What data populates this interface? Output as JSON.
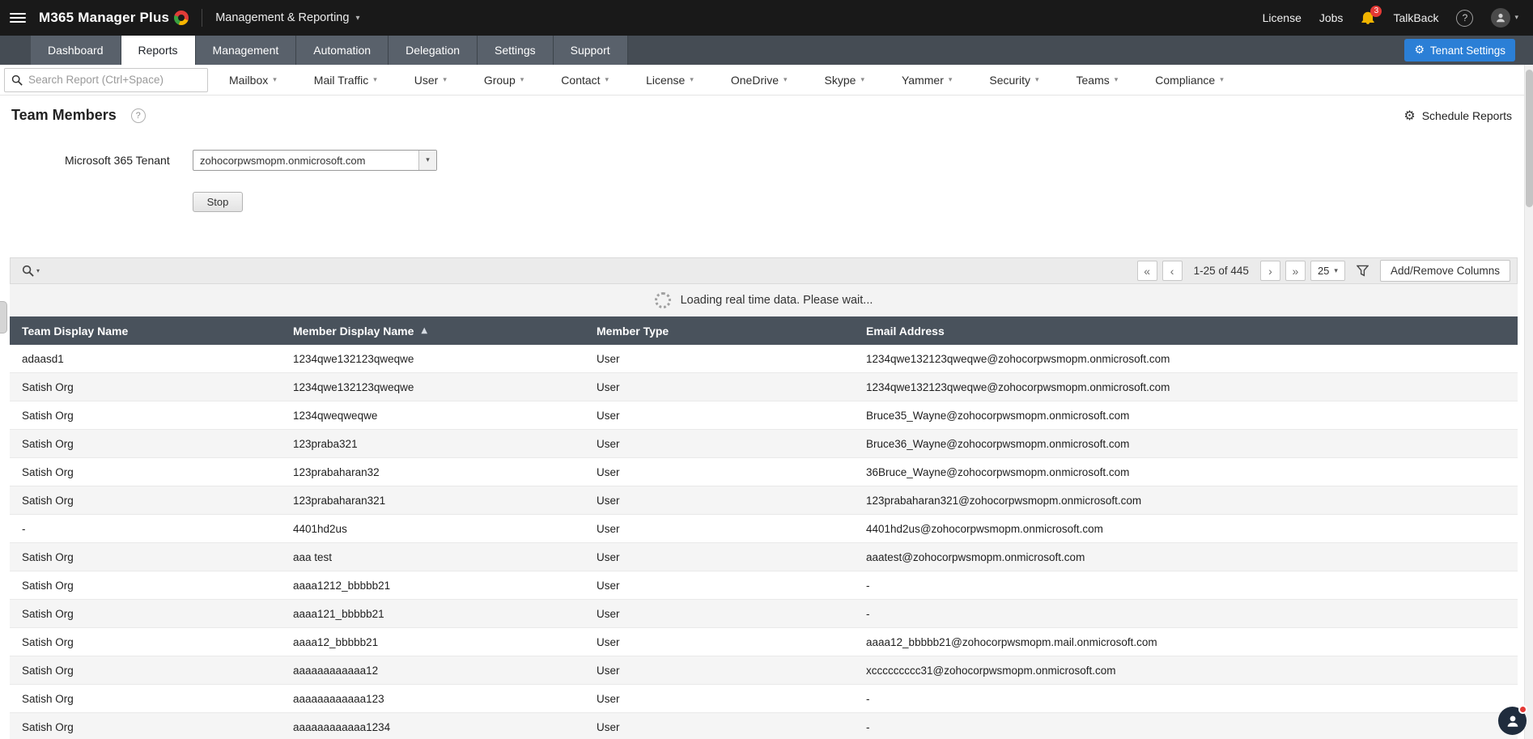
{
  "topbar": {
    "app_name": "M365 Manager Plus",
    "module": "Management & Reporting",
    "license": "License",
    "jobs": "Jobs",
    "notification_count": "3",
    "talkback": "TalkBack"
  },
  "nav": {
    "tabs": [
      "Dashboard",
      "Reports",
      "Management",
      "Automation",
      "Delegation",
      "Settings",
      "Support"
    ],
    "active_tab": "Reports",
    "tenant_settings": "Tenant Settings"
  },
  "report_bar": {
    "search_placeholder": "Search Report (Ctrl+Space)",
    "categories": [
      "Mailbox",
      "Mail Traffic",
      "User",
      "Group",
      "Contact",
      "License",
      "OneDrive",
      "Skype",
      "Yammer",
      "Security",
      "Teams",
      "Compliance"
    ]
  },
  "page": {
    "title": "Team Members",
    "schedule_reports_label": "Schedule Reports",
    "tenant_label": "Microsoft 365 Tenant",
    "tenant_selected": "zohocorpwsmopm.onmicrosoft.com",
    "stop_label": "Stop",
    "loading_text": "Loading real time data. Please wait..."
  },
  "toolbar": {
    "range_label": "1-25 of 445",
    "page_size": "25",
    "add_remove_columns_label": "Add/Remove Columns"
  },
  "table": {
    "columns": [
      "Team Display Name",
      "Member Display Name",
      "Member Type",
      "Email Address"
    ],
    "sort": {
      "column": "Member Display Name",
      "direction": "asc"
    },
    "rows": [
      [
        "adaasd1",
        "1234qwe132123qweqwe",
        "User",
        "1234qwe132123qweqwe@zohocorpwsmopm.onmicrosoft.com"
      ],
      [
        "Satish Org",
        "1234qwe132123qweqwe",
        "User",
        "1234qwe132123qweqwe@zohocorpwsmopm.onmicrosoft.com"
      ],
      [
        "Satish Org",
        "1234qweqweqwe",
        "User",
        "Bruce35_Wayne@zohocorpwsmopm.onmicrosoft.com"
      ],
      [
        "Satish Org",
        "123praba321",
        "User",
        "Bruce36_Wayne@zohocorpwsmopm.onmicrosoft.com"
      ],
      [
        "Satish Org",
        "123prabaharan32",
        "User",
        "36Bruce_Wayne@zohocorpwsmopm.onmicrosoft.com"
      ],
      [
        "Satish Org",
        "123prabaharan321",
        "User",
        "123prabaharan321@zohocorpwsmopm.onmicrosoft.com"
      ],
      [
        "-",
        "4401hd2us",
        "User",
        "4401hd2us@zohocorpwsmopm.onmicrosoft.com"
      ],
      [
        "Satish Org",
        "aaa test",
        "User",
        "aaatest@zohocorpwsmopm.onmicrosoft.com"
      ],
      [
        "Satish Org",
        "aaaa1212_bbbbb21",
        "User",
        "-"
      ],
      [
        "Satish Org",
        "aaaa121_bbbbb21",
        "User",
        "-"
      ],
      [
        "Satish Org",
        "aaaa12_bbbbb21",
        "User",
        "aaaa12_bbbbb21@zohocorpwsmopm.mail.onmicrosoft.com"
      ],
      [
        "Satish Org",
        "aaaaaaaaaaaa12",
        "User",
        "xccccccccc31@zohocorpwsmopm.onmicrosoft.com"
      ],
      [
        "Satish Org",
        "aaaaaaaaaaaa123",
        "User",
        "-"
      ],
      [
        "Satish Org",
        "aaaaaaaaaaaa1234",
        "User",
        "-"
      ]
    ]
  },
  "icons": {
    "chevron_down": "▾",
    "select_caret": "▾",
    "sort_asc": "▲",
    "first_page": "«",
    "prev_page": "‹",
    "next_page": "›",
    "last_page": "»",
    "gear": "⚙",
    "question": "?"
  },
  "colors": {
    "accent_blue": "#2b7fd6",
    "topbar_bg": "#191919",
    "nav_bg": "#454c54",
    "table_header_bg": "#49525c",
    "badge_red": "#e53935"
  }
}
